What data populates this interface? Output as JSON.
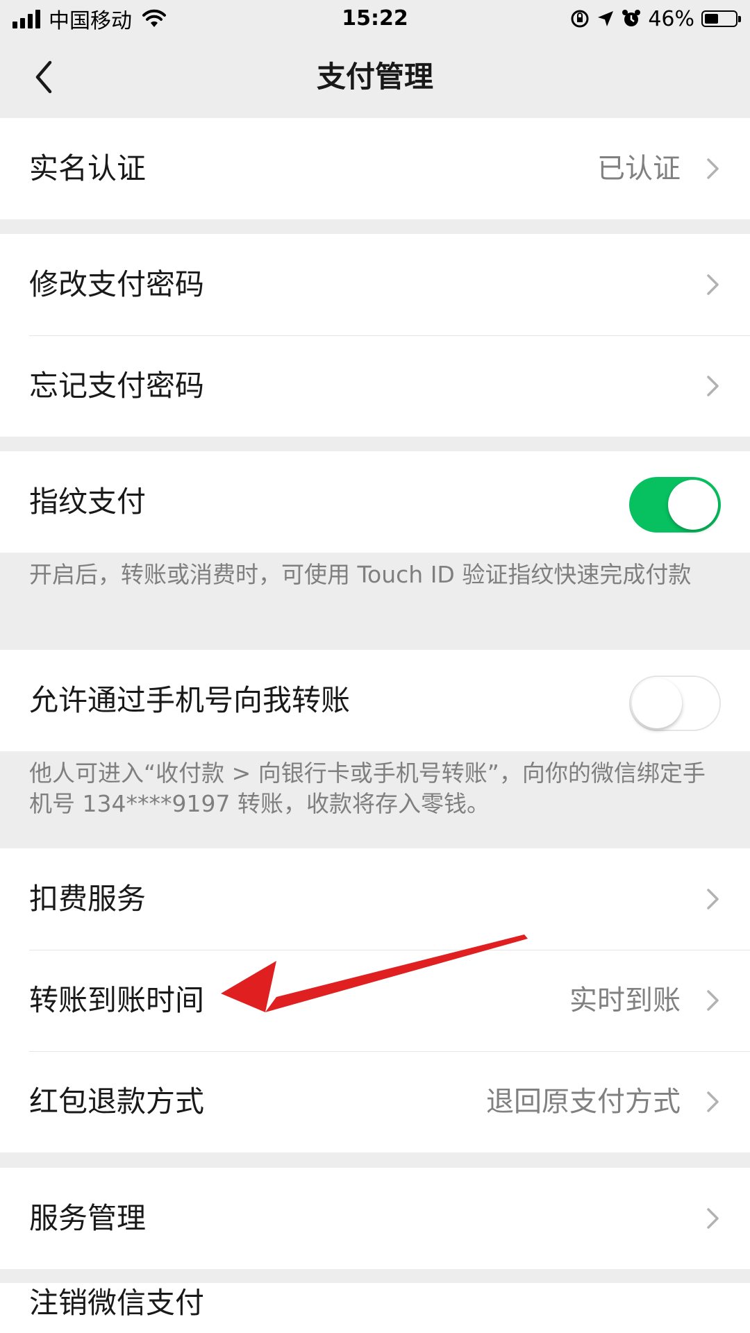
{
  "status_bar": {
    "carrier": "中国移动",
    "time": "15:22",
    "battery": "46%",
    "battery_level": 0.46
  },
  "nav": {
    "title": "支付管理",
    "back_icon": "chevron-left-icon"
  },
  "groups": [
    {
      "rows": [
        {
          "label": "实名认证",
          "value": "已认证"
        }
      ]
    },
    {
      "rows": [
        {
          "label": "修改支付密码"
        },
        {
          "label": "忘记支付密码"
        }
      ]
    },
    {
      "rows": [
        {
          "label": "指纹支付",
          "toggle": true
        }
      ],
      "note": "开启后，转账或消费时，可使用 Touch ID 验证指纹快速完成付款"
    },
    {
      "rows": [
        {
          "label": "允许通过手机号向我转账",
          "toggle": false
        }
      ],
      "note": "他人可进入“收付款 > 向银行卡或手机号转账”，向你的微信绑定手机号 134****9197 转账，收款将存入零钱。"
    },
    {
      "rows": [
        {
          "label": "扣费服务"
        },
        {
          "label": "转账到账时间",
          "value": "实时到账"
        },
        {
          "label": "红包退款方式",
          "value": "退回原支付方式"
        }
      ]
    },
    {
      "rows": [
        {
          "label": "服务管理"
        }
      ]
    },
    {
      "rows": [
        {
          "label": "注销微信支付"
        }
      ]
    }
  ],
  "colors": {
    "toggle_on": "#07c160",
    "arrow": "#e02020",
    "background": "#ededed"
  },
  "annotation": {
    "icon": "red-arrow-icon"
  }
}
